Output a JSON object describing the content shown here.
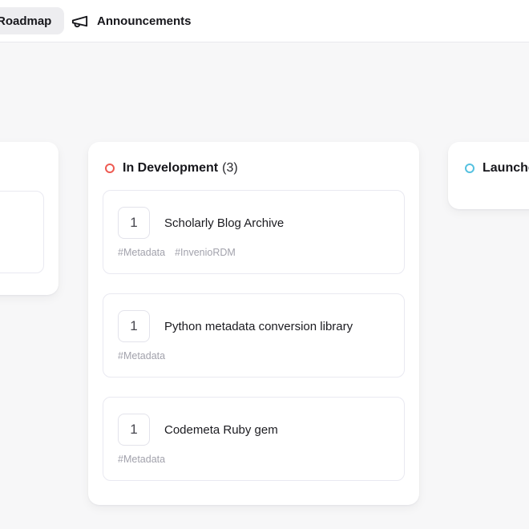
{
  "nav": {
    "roadmap_tab": "Roadmap",
    "announcements_tab": "Announcements"
  },
  "board": {
    "columns": {
      "in_development": {
        "title": "In Development",
        "count": "(3)",
        "dot_color": "#ee5a52",
        "cards": [
          {
            "votes": "1",
            "title": "Scholarly Blog Archive",
            "tags": [
              "#Metadata",
              "#InvenioRDM"
            ]
          },
          {
            "votes": "1",
            "title": "Python metadata conversion library",
            "tags": [
              "#Metadata"
            ]
          },
          {
            "votes": "1",
            "title": "Codemeta Ruby gem",
            "tags": [
              "#Metadata"
            ]
          }
        ]
      },
      "launched": {
        "title": "Launched",
        "dot_color": "#55c1e0"
      }
    }
  },
  "colors": {
    "page_background": "#f7f7f8",
    "in_development_dot": "#ee5a52",
    "launched_dot": "#55c1e0"
  }
}
